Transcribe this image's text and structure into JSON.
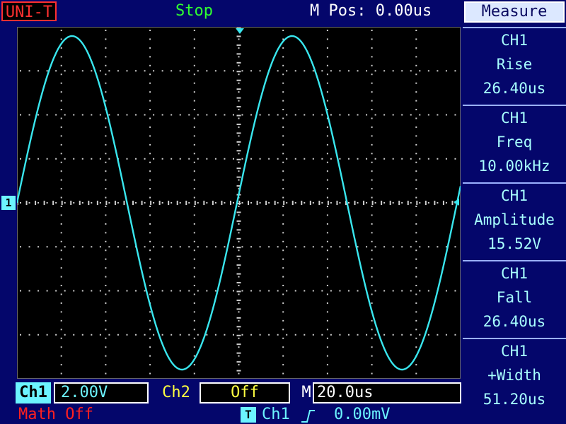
{
  "header": {
    "brand": "UNI-T",
    "status": "Stop",
    "mpos": "M Pos: 0.00us"
  },
  "sidebar": {
    "title": "Measure",
    "items": [
      {
        "channel": "CH1",
        "label": "Rise",
        "value": "26.40us"
      },
      {
        "channel": "CH1",
        "label": "Freq",
        "value": "10.00kHz"
      },
      {
        "channel": "CH1",
        "label": "Amplitude",
        "value": "15.52V"
      },
      {
        "channel": "CH1",
        "label": "Fall",
        "value": "26.40us"
      },
      {
        "channel": "CH1",
        "label": "+Width",
        "value": "51.20us"
      }
    ]
  },
  "footer": {
    "ch1_label": "Ch1",
    "ch1_scale": "2.00V",
    "ch2_label": "Ch2",
    "ch2_scale": "Off",
    "m_label": "M",
    "timebase": "20.0us",
    "math": "Math Off",
    "trigger_icon": "T",
    "trigger_source": "Ch1",
    "trigger_edge": "rising-edge-icon",
    "trigger_level": "0.00mV"
  },
  "channel_marker": "1",
  "colors": {
    "trace": "#39e6ee",
    "grid": "#cfcfcf",
    "background": "#04066b",
    "screen": "#000000"
  }
}
